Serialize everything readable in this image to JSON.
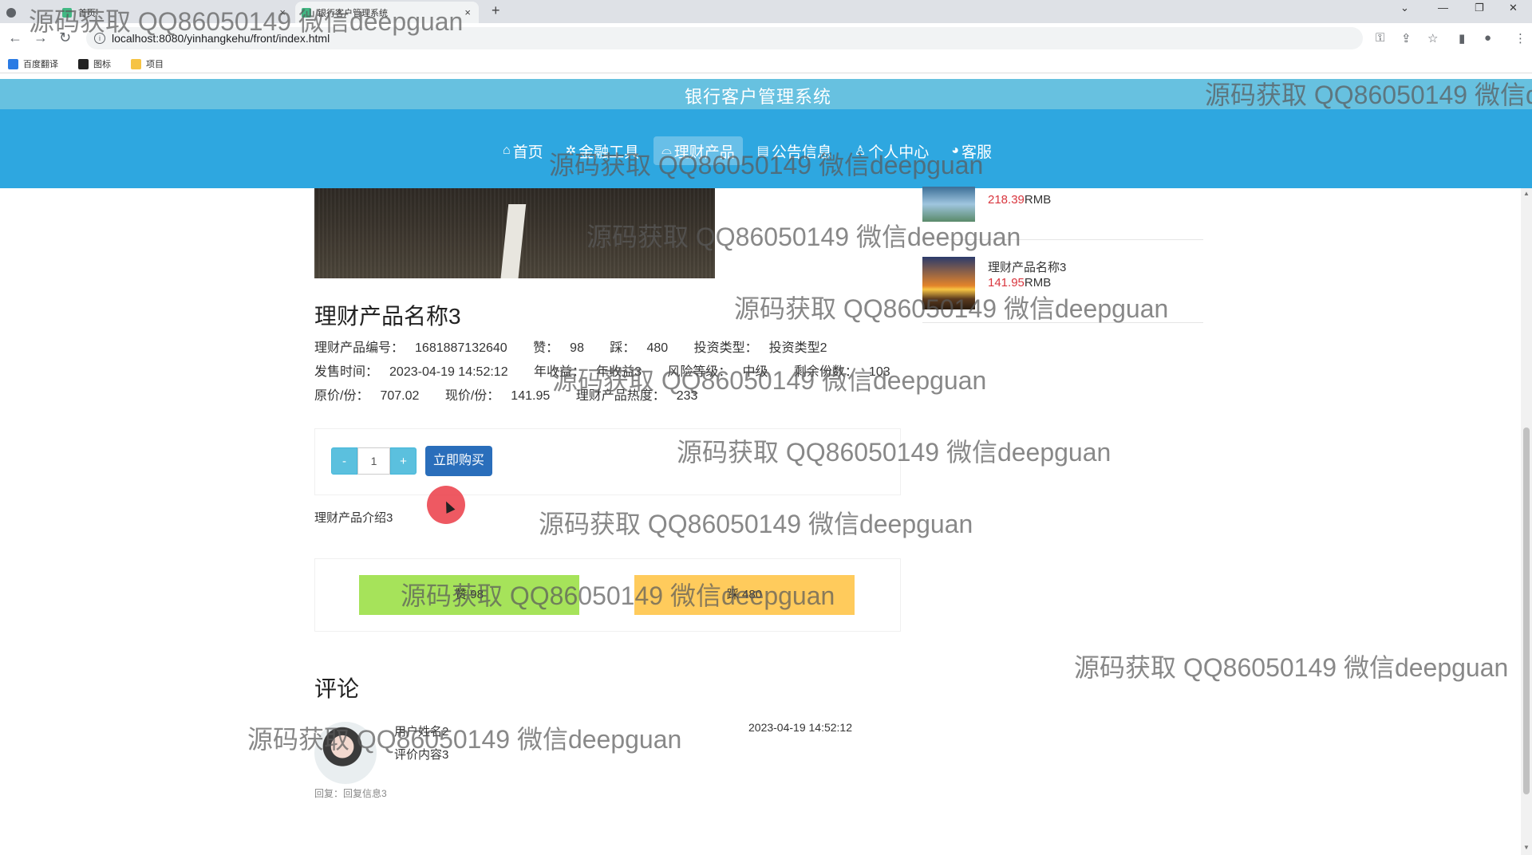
{
  "browser": {
    "tabs": [
      {
        "title": "首页",
        "active": false
      },
      {
        "title": "银行客户管理系统",
        "active": true
      }
    ],
    "new_tab": "+",
    "url": "localhost:8080/yinhangkehu/front/index.html",
    "bookmarks": [
      "百度翻译",
      "图标",
      "项目"
    ]
  },
  "site": {
    "title": "银行客户管理系统",
    "nav": [
      {
        "label": "首页",
        "icon": "home-icon",
        "active": false
      },
      {
        "label": "金融工具",
        "icon": "tool-icon",
        "active": false
      },
      {
        "label": "理财产品",
        "icon": "graduation-cap-icon",
        "active": true
      },
      {
        "label": "公告信息",
        "icon": "notice-icon",
        "active": false
      },
      {
        "label": "个人中心",
        "icon": "user-icon",
        "active": false
      },
      {
        "label": "客服",
        "icon": "support-icon",
        "active": false
      }
    ]
  },
  "product": {
    "name": "理财产品名称3",
    "code_label": "理财产品编号：",
    "code": "1681887132640",
    "like_label": "赞：",
    "like": "98",
    "dislike_label": "踩：",
    "dislike": "480",
    "type_label": "投资类型：",
    "type": "投资类型2",
    "time_label": "发售时间：",
    "time": "2023-04-19 14:52:12",
    "annual_label": "年收益：",
    "annual": "年收益3",
    "risk_label": "风险等级：",
    "risk": "中级",
    "remain_label": "剩余份数：",
    "remain": "103",
    "orig_label": "原价/份：",
    "orig": "707.02",
    "now_label": "现价/份：",
    "now": "141.95",
    "hot_label": "理财产品热度：",
    "hot": "233",
    "intro": "理财产品介绍3"
  },
  "purchase": {
    "minus": "-",
    "qty": "1",
    "plus": "+",
    "buy_label": "立即购买"
  },
  "vote": {
    "like_label": "赞 98",
    "dislike_label": "踩 480"
  },
  "comments": {
    "title": "评论",
    "items": [
      {
        "user": "用户姓名2",
        "text": "评价内容3",
        "time": "2023-04-19 14:52:12",
        "reply": "回复：回复信息3"
      }
    ]
  },
  "sidebar": {
    "items": [
      {
        "name": "",
        "price": "218.39",
        "unit": "RMB"
      },
      {
        "name": "理财产品名称3",
        "price": "141.95",
        "unit": "RMB"
      }
    ]
  },
  "watermark": "源码获取 QQ86050149 微信deepguan",
  "watermark_cut": "源码获取 QQ86050149 微信d",
  "colors": {
    "title_bar": "#67c1e0",
    "nav_bar": "#2ea7e0",
    "buy_button": "#2a6ebb",
    "qty_buttons": "#5bc0de",
    "like": "#a6e35a",
    "dislike": "#ffcb5c",
    "price": "#d9363e"
  }
}
